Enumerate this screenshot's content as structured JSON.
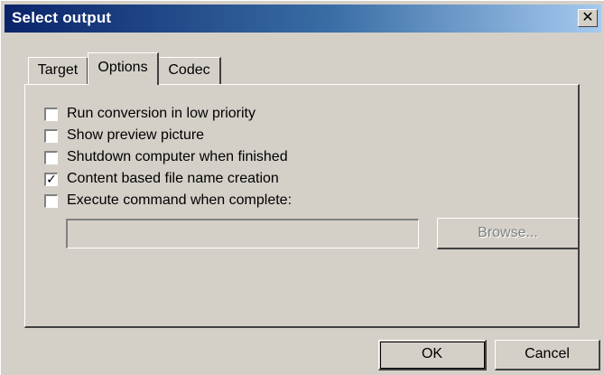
{
  "window": {
    "title": "Select output",
    "close_glyph": "✕"
  },
  "tabs": [
    {
      "label": "Target",
      "selected": false
    },
    {
      "label": "Options",
      "selected": true
    },
    {
      "label": "Codec",
      "selected": false
    }
  ],
  "options": [
    {
      "label": "Run conversion in low priority",
      "checked": false
    },
    {
      "label": "Show preview picture",
      "checked": false
    },
    {
      "label": "Shutdown computer when finished",
      "checked": false
    },
    {
      "label": "Content based file name creation",
      "checked": true
    },
    {
      "label": "Execute command when complete:",
      "checked": false
    }
  ],
  "command": {
    "value": "",
    "enabled": false
  },
  "buttons": {
    "browse": "Browse...",
    "ok": "OK",
    "cancel": "Cancel"
  },
  "icons": {
    "check_glyph": "✓"
  },
  "colors": {
    "face": "#d4d0c8",
    "title_start": "#0a246a",
    "title_end": "#a6caf0",
    "disabled_text": "#808080"
  }
}
